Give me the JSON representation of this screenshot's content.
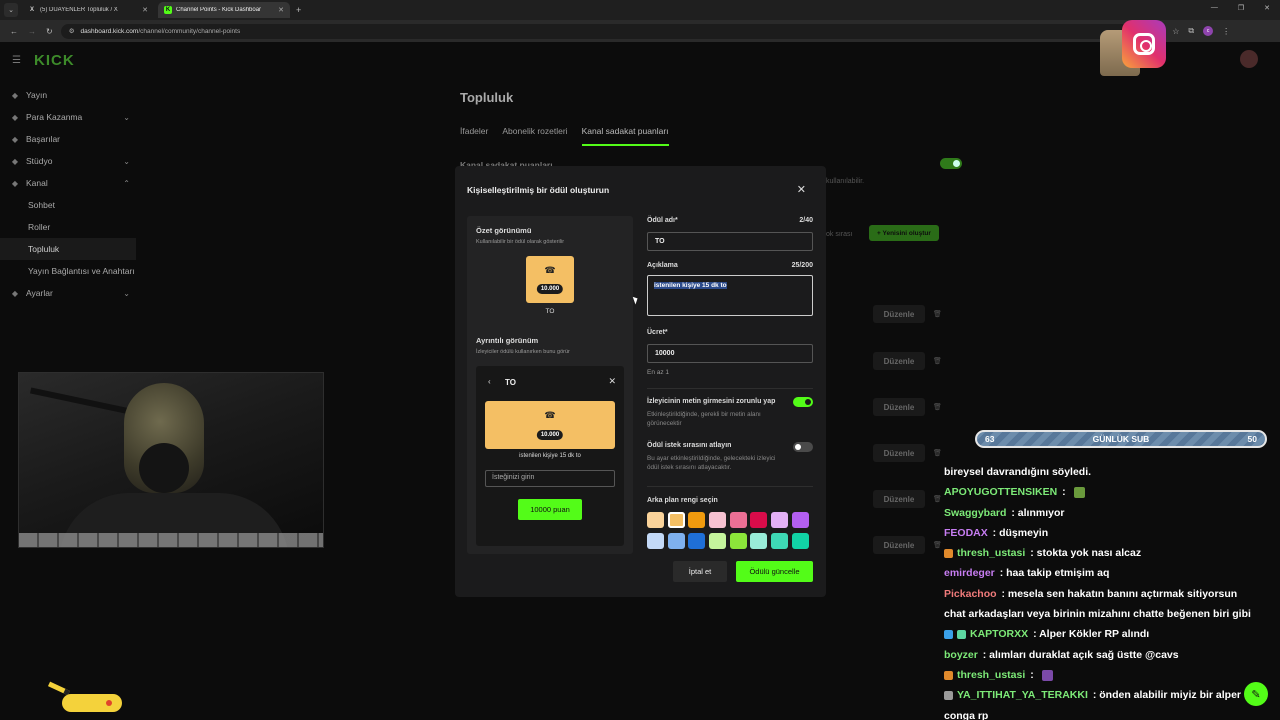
{
  "browser": {
    "tabs": [
      {
        "label": "(5) DUAYENLER Topluluk / X",
        "favicon": "X",
        "active": false
      },
      {
        "label": "Channel Points - Kick Dashboar",
        "favicon": "K",
        "active": true
      }
    ],
    "url_host": "dashboard.kick.com",
    "url_path": "/channel/community/channel-points",
    "profile_initial": "c"
  },
  "dashboard": {
    "logo": "KICK",
    "sidebar": [
      {
        "label": "Yayın",
        "icon": "broadcast-icon",
        "chevron": "",
        "sub": false,
        "active": false
      },
      {
        "label": "Para Kazanma",
        "icon": "money-icon",
        "chevron": "⌄",
        "sub": false,
        "active": false
      },
      {
        "label": "Başarılar",
        "icon": "trophy-icon",
        "chevron": "",
        "sub": false,
        "active": false
      },
      {
        "label": "Stüdyo",
        "icon": "studio-icon",
        "chevron": "⌄",
        "sub": false,
        "active": false
      },
      {
        "label": "Kanal",
        "icon": "channel-icon",
        "chevron": "⌃",
        "sub": false,
        "active": false
      },
      {
        "label": "Sohbet",
        "icon": "",
        "chevron": "",
        "sub": true,
        "active": false
      },
      {
        "label": "Roller",
        "icon": "",
        "chevron": "",
        "sub": true,
        "active": false
      },
      {
        "label": "Topluluk",
        "icon": "",
        "chevron": "",
        "sub": true,
        "active": true
      },
      {
        "label": "Yayın Bağlantısı ve Anahtarı",
        "icon": "",
        "chevron": "",
        "sub": true,
        "active": false
      },
      {
        "label": "Ayarlar",
        "icon": "settings-icon",
        "chevron": "⌄",
        "sub": false,
        "active": false
      }
    ],
    "page_title": "Topluluk",
    "tabs": [
      "İfadeler",
      "Abonelik rozetleri",
      "Kanal sadakat puanları"
    ],
    "active_tab": 2,
    "faded_section_title": "Kanal sadakat puanları",
    "faded_note": "kullanılabilir.",
    "faded_queue": "ok sırası",
    "new_button": "+ Yenisini oluştur",
    "edit_label": "Düzenle"
  },
  "modal": {
    "title": "Kişiselleştirilmiş bir ödül oluşturun",
    "summary_title": "Özet görünümü",
    "summary_sub": "Kullanılabilir bir ödül olarak gösterilir",
    "cost_display": "10.000",
    "reward_name": "TO",
    "detail_title": "Ayrıntılı görünüm",
    "detail_sub": "İzleyiciler ödülü kullanırken bunu görür",
    "detail_desc": "istenilen kişiye 15 dk to",
    "request_placeholder": "İsteğinizi girin",
    "buy_label": "10000 puan",
    "name_label": "Ödül adı*",
    "name_count": "2/40",
    "name_value": "TO",
    "desc_label": "Açıklama",
    "desc_count": "25/200",
    "desc_value": "istenilen kişiye 15 dk to",
    "cost_label": "Ücret*",
    "cost_value": "10000",
    "cost_note": "En az 1",
    "toggle1_title": "İzleyicinin metin girmesini zorunlu yap",
    "toggle1_desc": "Etkinleştirildiğinde, gerekli bir metin alanı görünecektir",
    "toggle1_on": true,
    "toggle2_title": "Ödül istek sırasını atlayın",
    "toggle2_desc": "Bu ayar etkinleştirildiğinde, gelecekteki izleyici ödül istek sırasını atlayacaktır.",
    "toggle2_on": false,
    "color_label": "Arka plan rengi seçin",
    "colors": [
      "#fad39a",
      "#f4bf64",
      "#f09a0e",
      "#f7c2d2",
      "#ec6f95",
      "#d90c4a",
      "#e3b0f5",
      "#b45ff2",
      "#c3d9f7",
      "#7fb1ef",
      "#1f6fd6",
      "#c5f59c",
      "#8ce53a",
      "#99ecd8",
      "#3ed9b5",
      "#11d3a6"
    ],
    "selected_color": 1,
    "cancel_label": "İptal et",
    "save_label": "Ödülü güncelle"
  },
  "stream": {
    "sub_goal_current": "63",
    "sub_goal_label": "GÜNLÜK SUB",
    "sub_goal_target": "50"
  },
  "chat": [
    {
      "user": "",
      "color": "#ffffff",
      "text": "bireysel davrandığını söyledi.",
      "badges": [],
      "emote": ""
    },
    {
      "user": "APOYUGOTTENSIKEN",
      "color": "#7dea78",
      "text": " : ",
      "badges": [],
      "emote": "#6a9a3c"
    },
    {
      "user": "Swaggybard",
      "color": "#7dea78",
      "text": " : alınmıyor",
      "badges": [],
      "emote": ""
    },
    {
      "user": "FEODAX",
      "color": "#c77df2",
      "text": " : düşmeyin",
      "badges": [],
      "emote": ""
    },
    {
      "user": "thresh_ustasi",
      "color": "#7dea78",
      "text": " : stokta yok nası alcaz",
      "badges": [
        "#e08a2c"
      ],
      "emote": ""
    },
    {
      "user": "emirdeger",
      "color": "#c77df2",
      "text": " : haa takip etmişim aq",
      "badges": [],
      "emote": ""
    },
    {
      "user": "Pickachoo",
      "color": "#f07b7b",
      "text": " : mesela sen hakatın banını açtırmak sitiyorsun",
      "badges": [],
      "emote": ""
    },
    {
      "user": "",
      "color": "#ffffff",
      "text": "chat arkadaşları veya birinin mizahını chatte beğenen biri gibi",
      "badges": [],
      "emote": ""
    },
    {
      "user": "KAPTORXX",
      "color": "#7dea78",
      "text": " : Alper Kökler RP alındı",
      "badges": [
        "#3aa0e8",
        "#5cd6a0"
      ],
      "emote": ""
    },
    {
      "user": "boyzer",
      "color": "#7dea78",
      "text": " : alımları duraklat açık sağ üstte @cavs",
      "badges": [],
      "emote": ""
    },
    {
      "user": "thresh_ustasi",
      "color": "#7dea78",
      "text": " : ",
      "badges": [
        "#e08a2c"
      ],
      "emote": "#7b4aa8"
    },
    {
      "user": "YA_ITTIHAT_YA_TERAKKI",
      "color": "#7dea78",
      "text": " : önden alabilir miyiz bir alper",
      "badges": [
        "#9a9a9a"
      ],
      "emote": ""
    },
    {
      "user": "",
      "color": "#ffffff",
      "text": "conga rp",
      "badges": [],
      "emote": ""
    }
  ]
}
